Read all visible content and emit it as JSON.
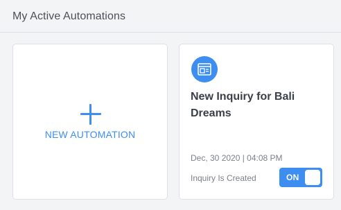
{
  "header": {
    "title": "My Active Automations"
  },
  "new_automation": {
    "label": "NEW AUTOMATION",
    "icon": "plus-icon"
  },
  "automations": [
    {
      "title": "New Inquiry for Bali Dreams",
      "date": "Dec, 30 2020 | 04:08 PM",
      "trigger": "Inquiry Is Created",
      "toggle_label": "ON",
      "enabled": true,
      "icon": "inquiry-form-icon"
    }
  ],
  "colors": {
    "accent": "#3d8ef0",
    "background": "#f3f4f5",
    "card": "#ffffff",
    "muted_text": "#7a808a"
  }
}
